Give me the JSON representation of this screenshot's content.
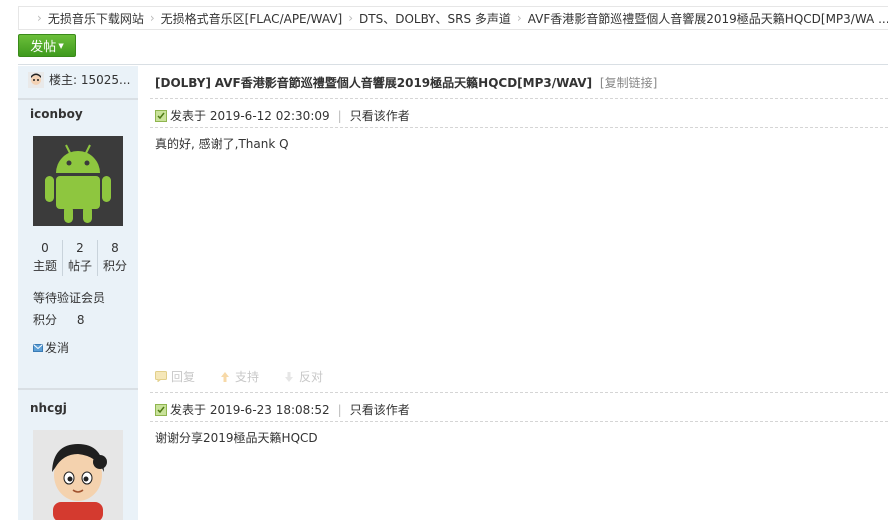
{
  "breadcrumb": {
    "items": [
      "无损音乐下载网站",
      "无损格式音乐区[FLAC/APE/WAV]",
      "DTS、DOLBY、SRS 多声道",
      "AVF香港影音節巡禮暨個人音響展2019極品天籟HQCD[MP3/WA ..."
    ]
  },
  "toolbar": {
    "post_label": "发帖"
  },
  "thread": {
    "op_label": "楼主: 15025...",
    "title_prefix": "[DOLBY]",
    "title": "AVF香港影音節巡禮暨個人音響展2019極品天籟HQCD[MP3/WAV]",
    "copy_link": "[复制链接]"
  },
  "posts": [
    {
      "author": "iconboy",
      "stats": [
        {
          "num": "0",
          "label": "主题"
        },
        {
          "num": "2",
          "label": "帖子"
        },
        {
          "num": "8",
          "label": "积分"
        }
      ],
      "group": "等待验证会员",
      "credit_label": "积分",
      "credit_value": "8",
      "pm_label": "发消",
      "posted_at": "发表于 2019-6-12 02:30:09",
      "only_author": "只看该作者",
      "content": "真的好, 感谢了,Thank Q",
      "actions": {
        "reply": "回复",
        "support": "支持",
        "oppose": "反对"
      }
    },
    {
      "author": "nhcgj",
      "posted_at": "发表于 2019-6-23 18:08:52",
      "only_author": "只看该作者",
      "content": "谢谢分享2019極品天籟HQCD"
    }
  ]
}
